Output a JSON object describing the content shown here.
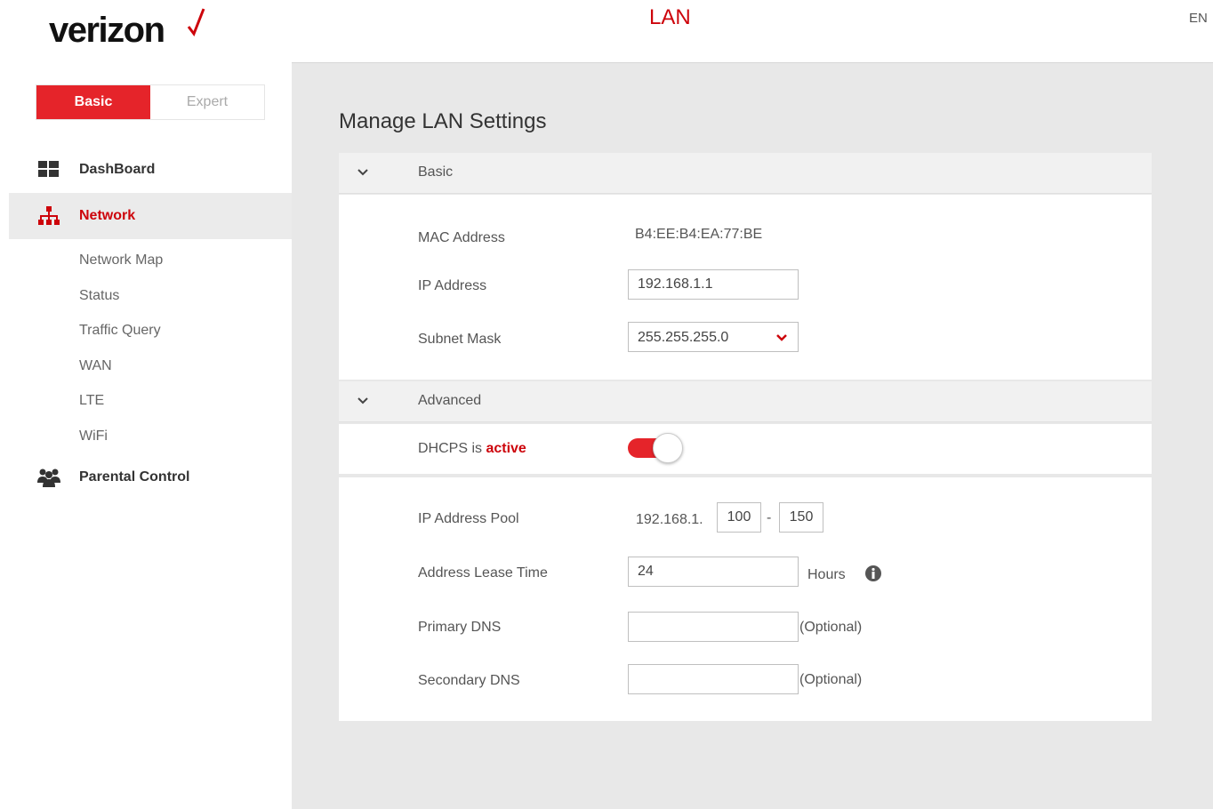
{
  "header": {
    "logo_text": "verizon",
    "page_heading": "LAN",
    "language": "EN"
  },
  "sidebar": {
    "mode": {
      "basic_label": "Basic",
      "expert_label": "Expert",
      "selected": "Basic"
    },
    "items": [
      {
        "label": "DashBoard",
        "icon": "dashboard-icon",
        "active": false
      },
      {
        "label": "Network",
        "icon": "network-icon",
        "active": true
      },
      {
        "label": "Parental Control",
        "icon": "parental-control-icon",
        "active": false
      }
    ],
    "network_subitems": [
      "Network Map",
      "Status",
      "Traffic Query",
      "WAN",
      "LTE",
      "WiFi"
    ]
  },
  "main": {
    "title": "Manage LAN Settings",
    "basic_section": {
      "header": "Basic",
      "mac_label": "MAC Address",
      "mac_value": "B4:EE:B4:EA:77:BE",
      "ip_label": "IP Address",
      "ip_value": "192.168.1.1",
      "subnet_label": "Subnet Mask",
      "subnet_value": "255.255.255.0"
    },
    "advanced_section": {
      "header": "Advanced",
      "dhcps_prefix": "DHCPS is ",
      "dhcps_state": "active",
      "dhcps_enabled": true,
      "pool_label": "IP Address Pool",
      "pool_prefix": "192.168.1.",
      "pool_start": "100",
      "pool_separator": "-",
      "pool_end": "150",
      "lease_label": "Address Lease Time",
      "lease_value": "24",
      "lease_unit": "Hours",
      "primary_dns_label": "Primary DNS",
      "primary_dns_value": "",
      "primary_dns_note": "(Optional)",
      "secondary_dns_label": "Secondary DNS",
      "secondary_dns_value": "",
      "secondary_dns_note": "(Optional)"
    }
  },
  "colors": {
    "brand_red": "#cd040b",
    "button_red": "#e5242a",
    "main_bg": "#e8e8e8"
  }
}
